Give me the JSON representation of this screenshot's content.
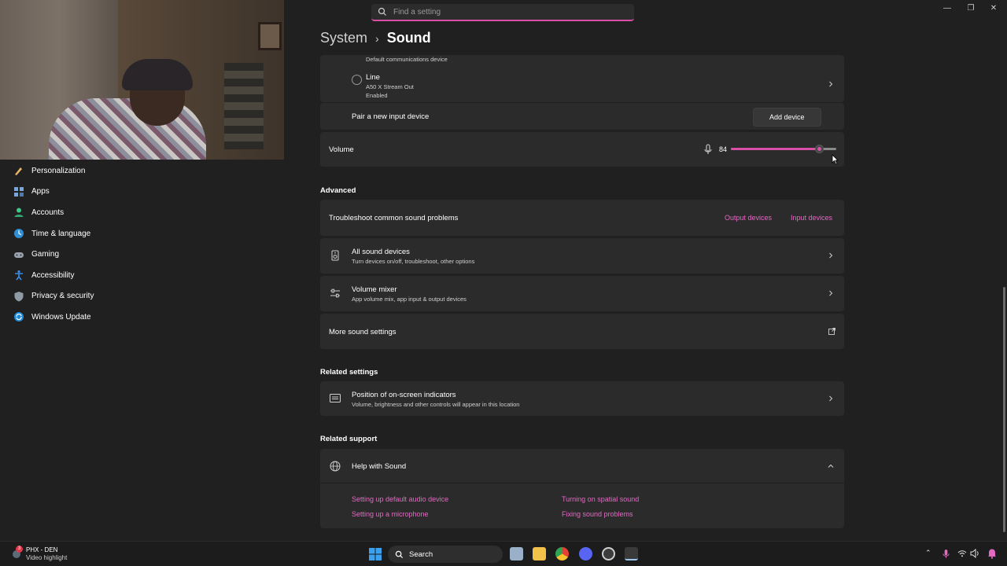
{
  "search": {
    "placeholder": "Find a setting"
  },
  "breadcrumb": {
    "parent": "System",
    "current": "Sound"
  },
  "sidebar": {
    "items": [
      {
        "label": "Personalization",
        "icon": "brush-icon"
      },
      {
        "label": "Apps",
        "icon": "apps-icon"
      },
      {
        "label": "Accounts",
        "icon": "accounts-icon"
      },
      {
        "label": "Time & language",
        "icon": "globe-clock-icon"
      },
      {
        "label": "Gaming",
        "icon": "controller-icon"
      },
      {
        "label": "Accessibility",
        "icon": "accessibility-icon"
      },
      {
        "label": "Privacy & security",
        "icon": "shield-icon"
      },
      {
        "label": "Windows Update",
        "icon": "update-icon"
      }
    ]
  },
  "input_devices": {
    "partial_subtitle": "Default communications device",
    "line": {
      "name": "Line",
      "detail": "A50 X Stream Out",
      "status": "Enabled"
    },
    "pair": {
      "label": "Pair a new input device",
      "button": "Add device"
    }
  },
  "volume": {
    "label": "Volume",
    "value": "84",
    "level": 0.84
  },
  "advanced": {
    "heading": "Advanced",
    "troubleshoot": {
      "label": "Troubleshoot common sound problems",
      "output_link": "Output devices",
      "input_link": "Input devices"
    },
    "all_devices": {
      "title": "All sound devices",
      "subtitle": "Turn devices on/off, troubleshoot, other options"
    },
    "mixer": {
      "title": "Volume mixer",
      "subtitle": "App volume mix, app input & output devices"
    },
    "more": {
      "label": "More sound settings"
    }
  },
  "related_settings": {
    "heading": "Related settings",
    "position": {
      "title": "Position of on-screen indicators",
      "subtitle": "Volume, brightness and other controls will appear in this location"
    }
  },
  "related_support": {
    "heading": "Related support",
    "help": {
      "title": "Help with Sound"
    },
    "links": [
      "Setting up default audio device",
      "Turning on spatial sound",
      "Setting up a microphone",
      "Fixing sound problems"
    ]
  },
  "taskbar": {
    "weather_title": "PHX - DEN",
    "weather_sub": "Video highlight",
    "badge": "3",
    "search_label": "Search"
  },
  "colors": {
    "accent": "#e26ac3",
    "bg": "#202020",
    "card": "#2b2b2b"
  }
}
